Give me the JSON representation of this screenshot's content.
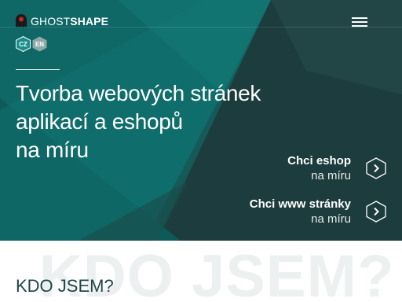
{
  "header": {
    "logo_light": "GHOST",
    "logo_bold": "SHAPE",
    "menu_icon": "hamburger-icon"
  },
  "languages": [
    {
      "code": "CZ",
      "active": true
    },
    {
      "code": "EN",
      "active": false
    }
  ],
  "hero": {
    "headline_lines": [
      "Tvorba webových stránek",
      "aplikací a eshopů",
      "na míru"
    ],
    "ctas": [
      {
        "title": "Chci eshop",
        "subtitle": "na míru",
        "icon": "chevron-right-icon"
      },
      {
        "title": "Chci www stránky",
        "subtitle": "na míru",
        "icon": "chevron-right-icon"
      }
    ]
  },
  "about": {
    "watermark": "KDO JSEM?",
    "title": "KDO JSEM?"
  },
  "colors": {
    "hero_dark": "#1c3c3d",
    "hero_teal": "#0e6a69",
    "accent_red": "#c1272d",
    "lang_active": "#1a8f8b",
    "lang_inactive": "#8fa9a8",
    "section_title": "#1f4548"
  }
}
